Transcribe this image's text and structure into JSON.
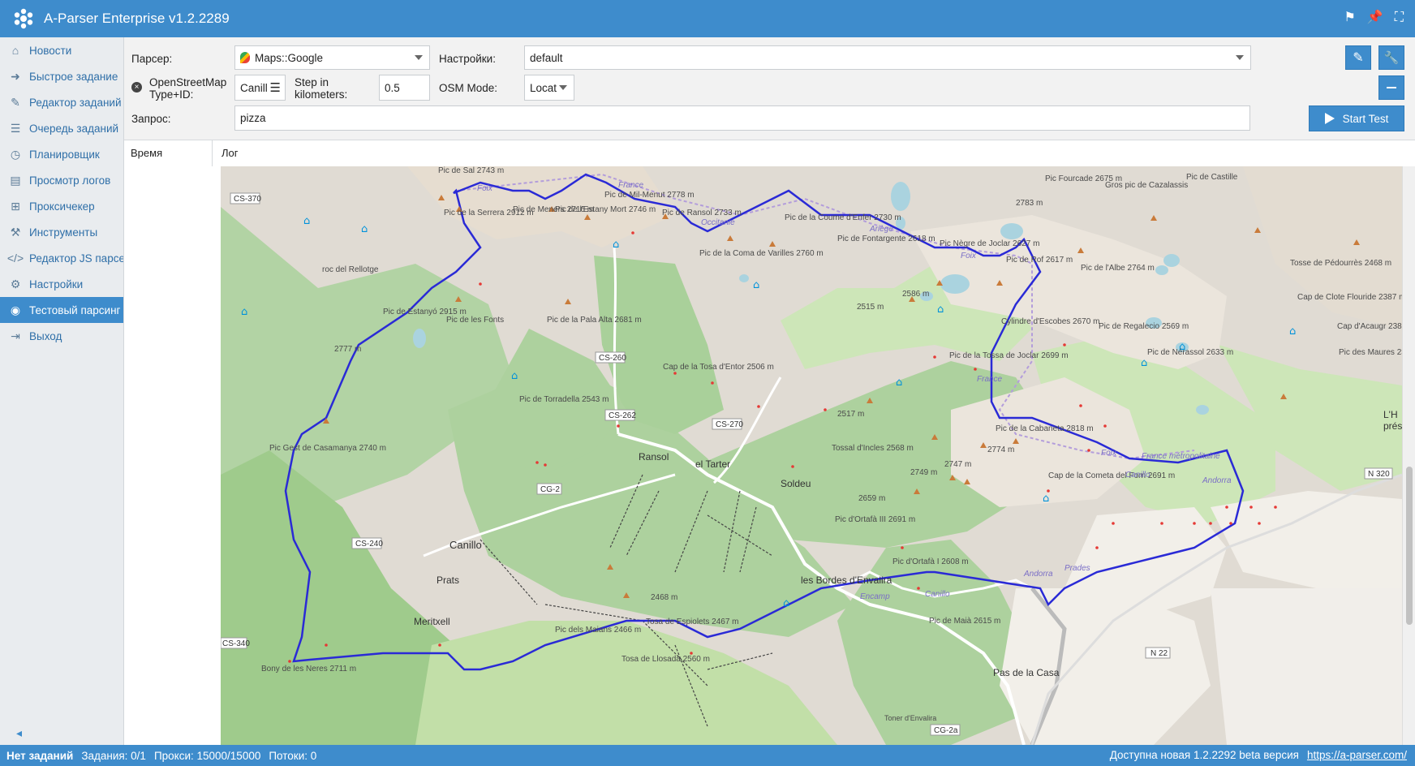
{
  "app": {
    "title": "A-Parser Enterprise v1.2.2289"
  },
  "sidebar": {
    "items": [
      {
        "label": "Новости",
        "icon": "home-icon"
      },
      {
        "label": "Быстрое задание",
        "icon": "arrow-right-icon"
      },
      {
        "label": "Редактор заданий",
        "icon": "pencil-icon"
      },
      {
        "label": "Очередь заданий",
        "icon": "list-icon"
      },
      {
        "label": "Планировщик",
        "icon": "clock-icon"
      },
      {
        "label": "Просмотр логов",
        "icon": "file-icon"
      },
      {
        "label": "Проксичекер",
        "icon": "sitemap-icon"
      },
      {
        "label": "Инструменты",
        "icon": "tools-icon"
      },
      {
        "label": "Редактор JS парсеров",
        "icon": "code-icon"
      },
      {
        "label": "Настройки",
        "icon": "gears-icon"
      },
      {
        "label": "Тестовый парсинг",
        "icon": "target-icon",
        "active": true
      },
      {
        "label": "Выход",
        "icon": "exit-icon"
      }
    ]
  },
  "form": {
    "parser_label": "Парсер:",
    "parser_value": "Maps::Google",
    "settings_label": "Настройки:",
    "settings_value": "default",
    "osm_label": "OpenStreetMap Type+ID:",
    "osm_value": "Canill",
    "step_label": "Step in kilometers:",
    "step_value": "0.5",
    "osm_mode_label": "OSM Mode:",
    "osm_mode_value": "Locat",
    "query_label": "Запрос:",
    "query_value": "pizza",
    "start_button": "Start Test"
  },
  "table": {
    "col_time": "Время",
    "col_log": "Лог"
  },
  "map": {
    "towns": [
      "Ransol",
      "el Tarter",
      "Soldeu",
      "Canillo",
      "Prats",
      "Meritxell",
      "les Bordes d'Envalira",
      "Pas de la Casa"
    ],
    "roads": [
      "CS-370",
      "CS-260",
      "CS-262",
      "CS-270",
      "CG-2",
      "CS-240",
      "CS-340",
      "CG-2a",
      "N 22",
      "N 320"
    ],
    "peaks": [
      "Pic de Sal 2743 m",
      "Pic de la Serrera 2912 m",
      "Pic de Meners 2716 m",
      "Pic de l'Estany Mort 2746 m",
      "Pic de Mil-Menut 2778 m",
      "Pic de Ransol 2733 m",
      "Pic de la Coma de Varilles 2760 m",
      "Pic de la Coume d'Enfer 2730 m",
      "Pic de Fontargente 2618 m",
      "Pic Nègre de Joclar 2627 m",
      "Pic Fourcade 2675 m",
      "Gros pic de Cazalassis",
      "Pic de Castille",
      "Tosse de Pédourrès 2468 m",
      "Pic de l'Albe 2764 m",
      "Cap de Clote Flouride 2387 m",
      "Cap d'Acaugr 2386 m",
      "Pic de Regalecio 2569 m",
      "Pic de Nérassol 2633 m",
      "Pic des Maures 2371 m",
      "roc del Rellotge",
      "Pic de Estanyó 2915 m",
      "Pic de les Fonts",
      "Pic de la Pala Alta 2681 m",
      "Cap de la Tosa d'Entor 2506 m",
      "Pic de Torradella 2543 m",
      "Pic Gest de Casamanya 2740 m",
      "Cylindre d'Escobes 2670 m",
      "Pic de la Tossa de Joclar 2699 m",
      "Pic de la Cabaneta 2818 m",
      "Cap de la Cometa del Forn 2691 m",
      "Tossal d'Incles 2568 m",
      "Pic d'Ortafà III 2691 m",
      "Pic d'Ortafà I 2608 m",
      "Pic de Maià 2615 m",
      "Pic dels Maians 2466 m",
      "Tosa de Espiolets 2467 m",
      "Tosa de Llosada 2560 m",
      "Bony de les Neres 2711 m",
      "Pic de Rof 2617 m"
    ],
    "elevations": [
      "2515 m",
      "2586 m",
      "2517 m",
      "2749 m",
      "2747 m",
      "2774 m",
      "2659 m",
      "2468 m",
      "2777 m",
      "2783 m"
    ],
    "borders": [
      "Foix",
      "France",
      "Occitanie",
      "Ariège",
      "Foix",
      "France",
      "Foix",
      "France métropolitaine",
      "Canillo",
      "Andorra",
      "Prades",
      "Encamp",
      "Canillo",
      "Andorra"
    ],
    "other": [
      "L'H",
      "prés",
      "Toner d'Envalira"
    ]
  },
  "status": {
    "state": "Нет заданий",
    "tasks": "Задания: 0/1",
    "proxies": "Прокси: 15000/15000",
    "threads": "Потоки: 0",
    "update": "Доступна новая 1.2.2292 beta версия",
    "link": "https://a-parser.com/"
  },
  "colors": {
    "accent": "#3e8ccc",
    "route": "#2a2ad6"
  }
}
